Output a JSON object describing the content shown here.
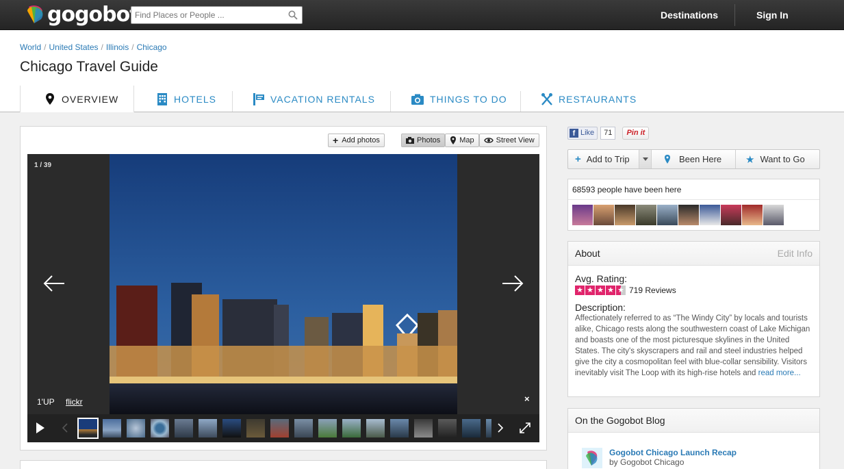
{
  "app": {
    "logo_text": "gogobot",
    "search_placeholder": "Find Places or People ...",
    "nav": {
      "destinations": "Destinations",
      "sign_in": "Sign In"
    }
  },
  "breadcrumb": [
    "World",
    "United States",
    "Illinois",
    "Chicago"
  ],
  "breadcrumb_sep": "/",
  "page_title": "Chicago Travel Guide",
  "tabs": [
    {
      "label": "OVERVIEW",
      "icon": "map-pin-icon",
      "active": true
    },
    {
      "label": "HOTELS",
      "icon": "hotel-building-icon",
      "active": false
    },
    {
      "label": "VACATION RENTALS",
      "icon": "vacation-rental-icon",
      "active": false
    },
    {
      "label": "THINGS TO DO",
      "icon": "camera-icon",
      "active": false
    },
    {
      "label": "RESTAURANTS",
      "icon": "fork-knife-icon",
      "active": false
    }
  ],
  "media": {
    "add_photos": "Add photos",
    "view_toggle": [
      "Photos",
      "Map",
      "Street View"
    ],
    "counter": "1 / 39",
    "credit": "1'UP",
    "source": "flickr",
    "close": "×"
  },
  "social": {
    "like": "Like",
    "like_count": "71",
    "pin": "Pin it"
  },
  "actions": {
    "add_to_trip": "Add to Trip",
    "been_here": "Been Here",
    "want_to_go": "Want to Go"
  },
  "been_here_count_text": "68593 people have been here",
  "about": {
    "title": "About",
    "edit": "Edit Info",
    "rating_label": "Avg. Rating:",
    "rating": 4.5,
    "reviews": "719 Reviews",
    "description_label": "Description:",
    "description": "Affectionately referred to as “The Windy City” by locals and tourists alike, Chicago rests along the southwestern coast of Lake Michigan and boasts one of the most picturesque skylines in the United States. The city's skyscrapers and rail and steel industries helped give the city a cosmopolitan feel with blue-collar sensibility. Visitors inevitably visit The Loop with its high-rise hotels and",
    "read_more": "read more..."
  },
  "blog": {
    "title": "On the Gogobot Blog",
    "post_title": "Gogobot Chicago Launch Recap",
    "post_by": "by Gogobot Chicago"
  },
  "colors": {
    "accent": "#2a8ac4",
    "rating": "#e0246b",
    "topbar": "#2e2e2e"
  }
}
